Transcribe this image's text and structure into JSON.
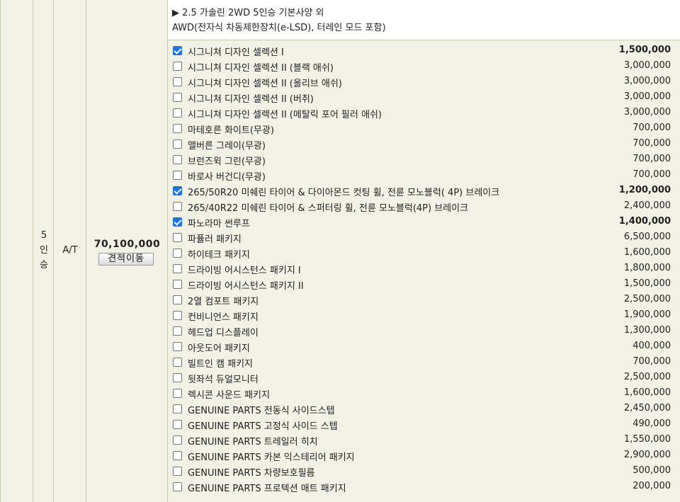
{
  "row": {
    "seats": [
      "5",
      "인",
      "승"
    ],
    "transmission": "A/T",
    "price": "70,100,000",
    "move_button": "견적이동"
  },
  "description": {
    "line1": "▶ 2.5 가솔린 2WD 5인승 기본사양 외",
    "line2": "AWD(전자식 차동제한장치(e-LSD), 터레인 모드 포함)"
  },
  "options": [
    {
      "name": "시그니쳐 디자인 셀렉션 I",
      "price": "1,500,000",
      "checked": true
    },
    {
      "name": "시그니쳐 디자인 셀렉션 II (블랙 애쉬)",
      "price": "3,000,000",
      "checked": false
    },
    {
      "name": "시그니쳐 디자인 셀렉션 II (올리브 애쉬)",
      "price": "3,000,000",
      "checked": false
    },
    {
      "name": "시그니쳐 디자인 셀렉션 II (버취)",
      "price": "3,000,000",
      "checked": false
    },
    {
      "name": "시그니쳐 디자인 셀렉션 II (메탈릭 포어 필러 애쉬)",
      "price": "3,000,000",
      "checked": false
    },
    {
      "name": "마테호른 화이트(무광)",
      "price": "700,000",
      "checked": false
    },
    {
      "name": "맬버른 그레이(무광)",
      "price": "700,000",
      "checked": false
    },
    {
      "name": "브런즈윅 그린(무광)",
      "price": "700,000",
      "checked": false
    },
    {
      "name": "바로사 버건디(무광)",
      "price": "700,000",
      "checked": false
    },
    {
      "name": "265/50R20 미쉐린 타이어 & 다이아몬드 컷팅 휠, 전륜 모노블럭( 4P) 브레이크",
      "price": "1,200,000",
      "checked": true
    },
    {
      "name": "265/40R22 미쉐린 타이어 & 스퍼터링 휠, 전륜 모노블럭(4P) 브레이크",
      "price": "2,400,000",
      "checked": false
    },
    {
      "name": "파노라마 썬루프",
      "price": "1,400,000",
      "checked": true
    },
    {
      "name": "파퓰러 패키지",
      "price": "6,500,000",
      "checked": false
    },
    {
      "name": "하이테크 패키지",
      "price": "1,600,000",
      "checked": false
    },
    {
      "name": "드라이빙 어시스턴스 패키지 I",
      "price": "1,800,000",
      "checked": false
    },
    {
      "name": "드라이빙 어시스턴스 패키지 II",
      "price": "1,500,000",
      "checked": false
    },
    {
      "name": "2열 컴포트 패키지",
      "price": "2,500,000",
      "checked": false
    },
    {
      "name": "컨비니언스 패키지",
      "price": "1,900,000",
      "checked": false
    },
    {
      "name": "헤드업 디스플레이",
      "price": "1,300,000",
      "checked": false
    },
    {
      "name": "아웃도어 패키지",
      "price": "400,000",
      "checked": false
    },
    {
      "name": "빌트인 캠 패키지",
      "price": "700,000",
      "checked": false
    },
    {
      "name": "뒷좌석 듀얼모니터",
      "price": "2,500,000",
      "checked": false
    },
    {
      "name": "렉시콘 사운드 패키지",
      "price": "1,600,000",
      "checked": false
    },
    {
      "name": "GENUINE PARTS 전동식 사이드스텝",
      "price": "2,450,000",
      "checked": false
    },
    {
      "name": "GENUINE PARTS 고정식 사이드 스텝",
      "price": "490,000",
      "checked": false
    },
    {
      "name": "GENUINE PARTS 트레일러 히치",
      "price": "1,550,000",
      "checked": false
    },
    {
      "name": "GENUINE PARTS 카본 익스테리어 패키지",
      "price": "2,900,000",
      "checked": false
    },
    {
      "name": "GENUINE PARTS 차량보호필름",
      "price": "500,000",
      "checked": false
    },
    {
      "name": "GENUINE PARTS 프로텍션 매트 패키지",
      "price": "200,000",
      "checked": false
    }
  ]
}
